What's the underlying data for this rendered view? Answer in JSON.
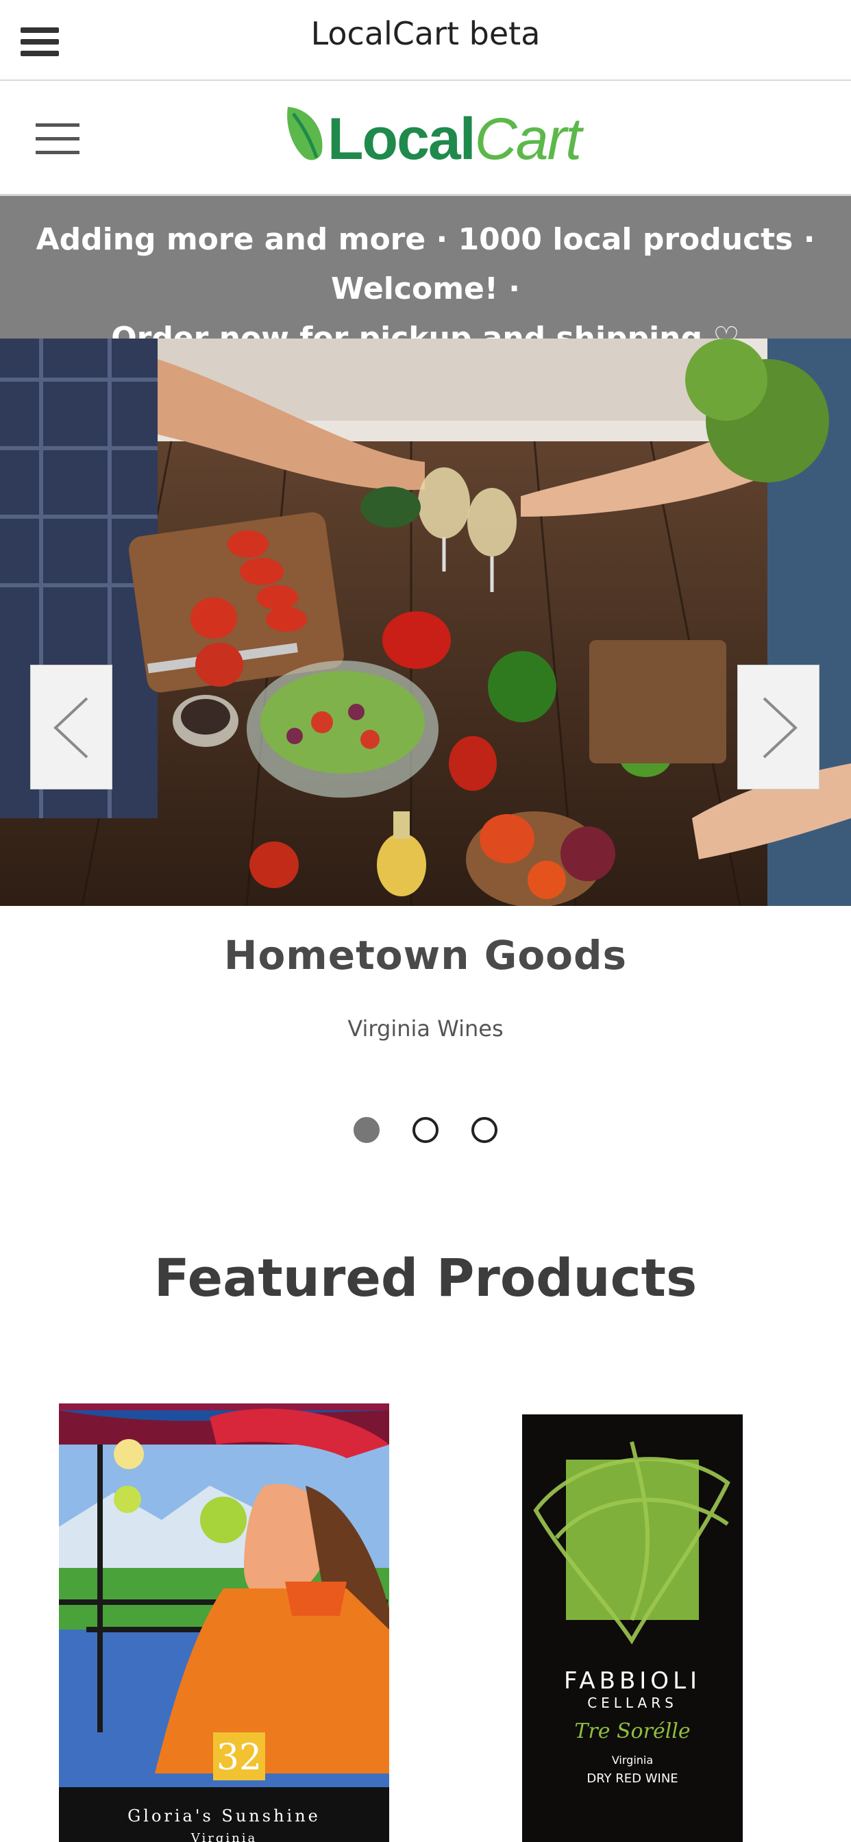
{
  "appbar": {
    "title": "LocalCart beta",
    "menu_icon": "hamburger-icon"
  },
  "site": {
    "menu_icon": "menu-icon",
    "logo": {
      "part1": "Local",
      "part2": "Cart",
      "icon": "leaf-icon"
    }
  },
  "banner": {
    "line1": "Adding more and more · 1000 local products · Welcome! ·",
    "line2": "Order now for pickup and shipping ♡"
  },
  "carousel": {
    "prev_icon": "chevron-left-icon",
    "next_icon": "chevron-right-icon",
    "slide_title": "Hometown Goods",
    "slide_subtitle": "Virginia Wines",
    "slide_count": 3,
    "active_index": 0
  },
  "featured": {
    "heading": "Featured Products",
    "products": [
      {
        "label_number": "32",
        "label_name": "Gloria's Sunshine",
        "label_sub": "Virginia"
      },
      {
        "label_brand": "FABBIOLI",
        "label_brand2": "CELLARS",
        "label_name": "Tre Sorélle",
        "label_region": "Virginia",
        "label_type": "DRY RED WINE"
      }
    ]
  },
  "colors": {
    "banner_bg": "#808080",
    "logo_green": "#1f8a4c",
    "logo_light_green": "#5cb84a"
  }
}
